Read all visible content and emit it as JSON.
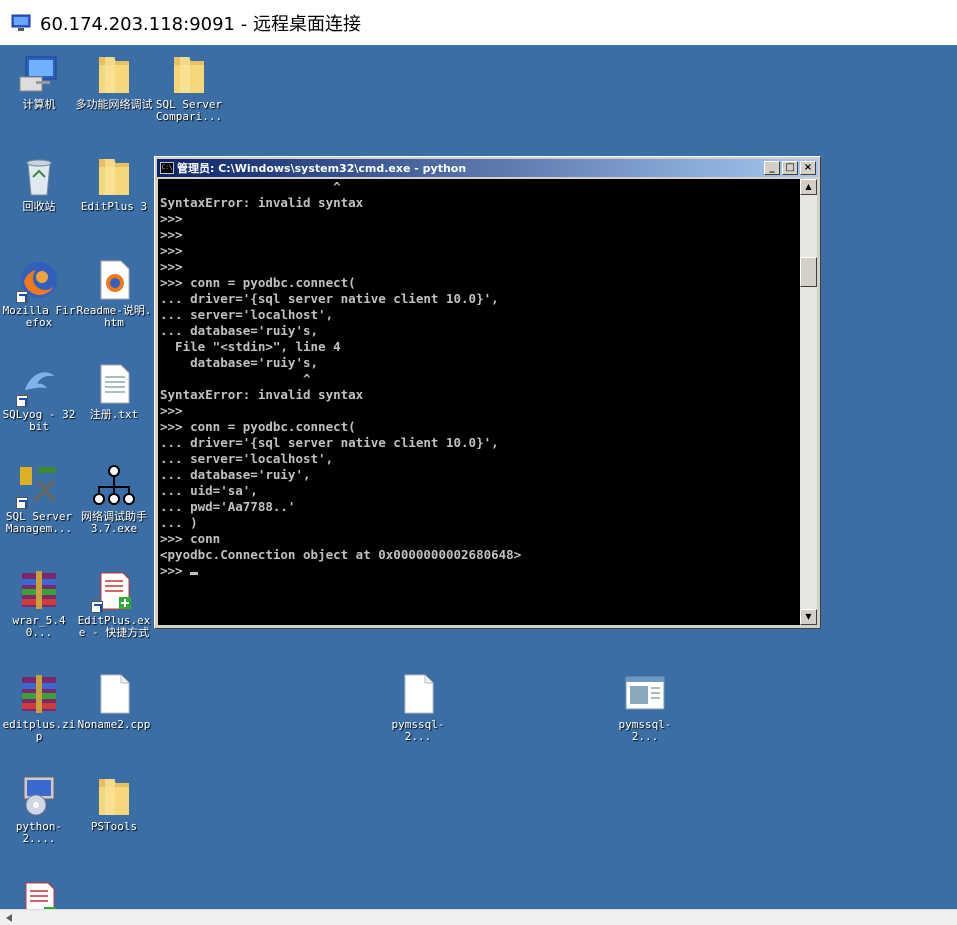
{
  "rdp_window": {
    "title": "60.174.203.118:9091 - 远程桌面连接",
    "icon": "remote-desktop-icon"
  },
  "desktop": {
    "background_color": "#3a6ea5",
    "icons": [
      {
        "name": "desktop-icon-computer",
        "label": "计算机",
        "icon": "computer-icon"
      },
      {
        "name": "desktop-icon-network-debug-folder",
        "label": "多功能网络调试",
        "icon": "folder-icon"
      },
      {
        "name": "desktop-icon-sql-server-compari",
        "label": "SQL Server Compari...",
        "icon": "folder-icon"
      },
      {
        "name": "desktop-icon-recycle-bin",
        "label": "回收站",
        "icon": "recycle-bin-icon"
      },
      {
        "name": "desktop-icon-editplus3",
        "label": "EditPlus 3",
        "icon": "folder-icon"
      },
      {
        "name": "desktop-icon-setup",
        "label": "",
        "icon": "installer-cd-icon"
      },
      {
        "name": "desktop-icon-firefox",
        "label": "Mozilla Firefox",
        "icon": "firefox-icon"
      },
      {
        "name": "desktop-icon-readme",
        "label": "Readme-说明.htm",
        "icon": "firefox-document-icon"
      },
      {
        "name": "desktop-icon-sqlyog",
        "label": "SQLyog - 32 bit",
        "icon": "dolphin-icon"
      },
      {
        "name": "desktop-icon-register-txt",
        "label": "注册.txt",
        "icon": "text-file-icon"
      },
      {
        "name": "desktop-icon-sql-server-management",
        "label": "SQL Server Managem...",
        "icon": "sql-tools-icon"
      },
      {
        "name": "desktop-icon-network-assistant",
        "label": "网络调试助手3.7.exe",
        "icon": "network-nodes-icon"
      },
      {
        "name": "desktop-icon-wrar",
        "label": "wrar_5.40...",
        "icon": "winrar-icon"
      },
      {
        "name": "desktop-icon-editplus-shortcut",
        "label": "EditPlus.exe - 快捷方式",
        "icon": "editplus-icon"
      },
      {
        "name": "desktop-icon-editplus-zip",
        "label": "editplus.zip",
        "icon": "winrar-icon"
      },
      {
        "name": "desktop-icon-noname2",
        "label": "Noname2.cpp",
        "icon": "blank-file-icon"
      },
      {
        "name": "desktop-icon-pymssql-1",
        "label": "pymssql-2...",
        "icon": "blank-file-icon"
      },
      {
        "name": "desktop-icon-pymssql-2",
        "label": "pymssql-2...",
        "icon": "installer-window-icon"
      },
      {
        "name": "desktop-icon-python",
        "label": "python-2....",
        "icon": "python-installer-icon"
      },
      {
        "name": "desktop-icon-pstools",
        "label": "PSTools",
        "icon": "folder-icon"
      },
      {
        "name": "desktop-icon-partial",
        "label": "",
        "icon": "editplus-icon"
      }
    ]
  },
  "cmd_window": {
    "title": "管理员: C:\\Windows\\system32\\cmd.exe - python",
    "minimize": "_",
    "maximize": "□",
    "close": "×",
    "lines": [
      "                       ^",
      "SyntaxError: invalid syntax",
      ">>>",
      ">>>",
      ">>>",
      ">>>",
      ">>> conn = pyodbc.connect(",
      "... driver='{sql server native client 10.0}',",
      "... server='localhost',",
      "... database='ruiy's,",
      "  File \"<stdin>\", line 4",
      "    database='ruiy's,",
      "                   ^",
      "SyntaxError: invalid syntax",
      ">>>",
      ">>> conn = pyodbc.connect(",
      "... driver='{sql server native client 10.0}',",
      "... server='localhost',",
      "... database='ruiy',",
      "... uid='sa',",
      "... pwd='Aa7788..'",
      "... )",
      ">>> conn",
      "<pyodbc.Connection object at 0x0000000002680648>",
      ">>> "
    ]
  }
}
